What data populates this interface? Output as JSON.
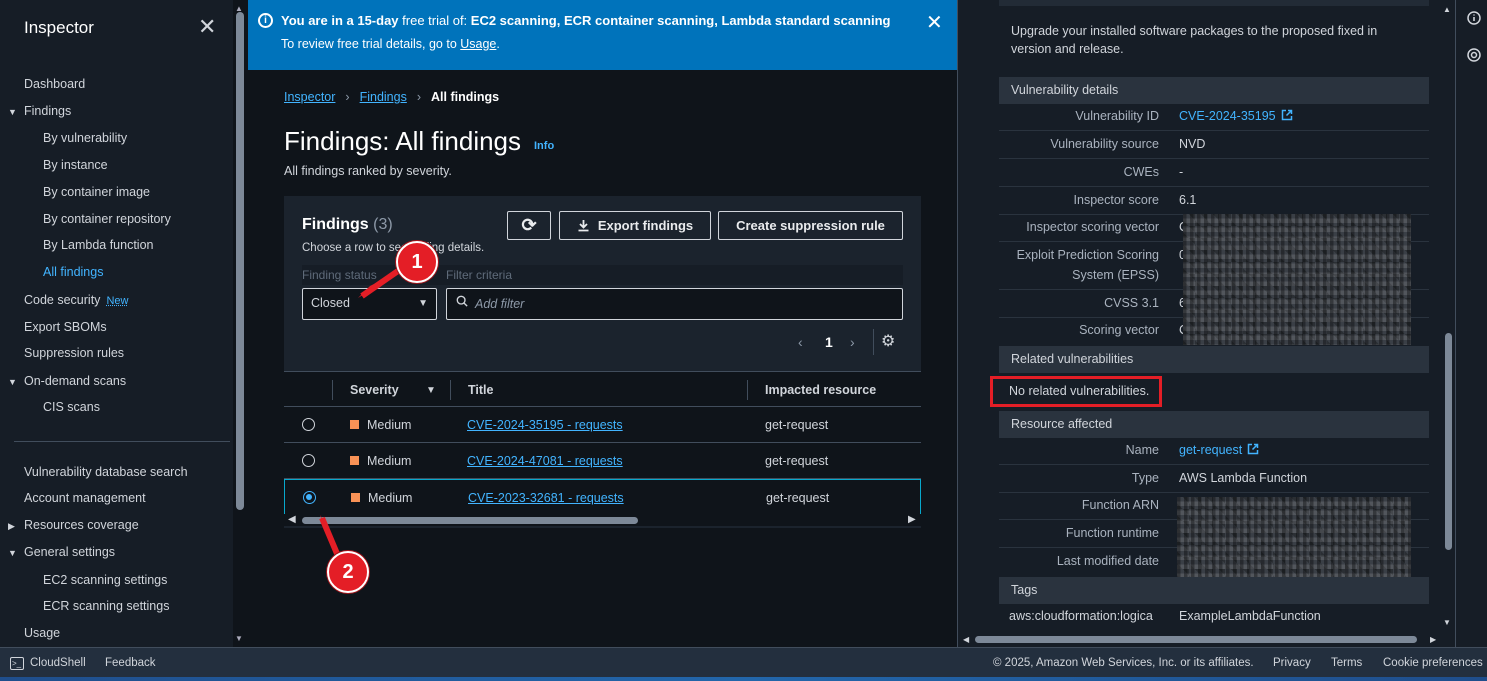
{
  "sidebar": {
    "title": "Inspector",
    "close_icon": "✕",
    "items": [
      {
        "label": "Dashboard"
      },
      {
        "label": "Findings"
      },
      {
        "label": "By vulnerability"
      },
      {
        "label": "By instance"
      },
      {
        "label": "By container image"
      },
      {
        "label": "By container repository"
      },
      {
        "label": "By Lambda function"
      },
      {
        "label": "All findings"
      },
      {
        "label": "Code security",
        "badge": "New"
      },
      {
        "label": "Export SBOMs"
      },
      {
        "label": "Suppression rules"
      },
      {
        "label": "On-demand scans"
      },
      {
        "label": "CIS scans"
      },
      {
        "label": "Vulnerability database search"
      },
      {
        "label": "Account management"
      },
      {
        "label": "Resources coverage"
      },
      {
        "label": "General settings"
      },
      {
        "label": "EC2 scanning settings"
      },
      {
        "label": "ECR scanning settings"
      },
      {
        "label": "Usage"
      }
    ]
  },
  "banner": {
    "prefix": "You are in a 15-day",
    "middle": " free trial of: ",
    "services": "EC2 scanning, ECR container scanning, Lambda standard scanning",
    "line2": "To review free trial details, go to ",
    "link": "Usage",
    "end": "."
  },
  "breadcrumb": {
    "items": [
      "Inspector",
      "Findings",
      "All findings"
    ]
  },
  "page": {
    "title": "Findings: All findings",
    "info": "Info",
    "subtitle": "All findings ranked by severity."
  },
  "findings_panel": {
    "title": "Findings",
    "count": "(3)",
    "description": "Choose a row to see finding details.",
    "refresh_label": "⟳",
    "export_label": "Export findings",
    "suppress_label": "Create suppression rule",
    "status_label": "Finding status",
    "status_value": "Closed",
    "criteria_label": "Filter criteria",
    "filter_placeholder": "Add filter",
    "page_number": "1",
    "columns": [
      "Severity",
      "Title",
      "Impacted resource"
    ],
    "rows": [
      {
        "severity": "Medium",
        "title": "CVE-2024-35195 - requests",
        "resource": "get-request",
        "selected": false
      },
      {
        "severity": "Medium",
        "title": "CVE-2024-47081 - requests",
        "resource": "get-request",
        "selected": false
      },
      {
        "severity": "Medium",
        "title": "CVE-2023-32681 - requests",
        "resource": "get-request",
        "selected": true
      }
    ]
  },
  "markers": {
    "one": "1",
    "two": "2"
  },
  "detail": {
    "remediation": "Upgrade your installed software packages to the proposed fixed in version and release.",
    "vuln_section": "Vulnerability details",
    "vuln_rows": [
      {
        "key": "Vulnerability ID",
        "value": "CVE-2024-35195"
      },
      {
        "key": "Vulnerability source",
        "value": "NVD"
      },
      {
        "key": "CWEs",
        "value": "-"
      },
      {
        "key": "Inspector score",
        "value": "6.1"
      },
      {
        "key": "Inspector scoring vector",
        "value": "C"
      },
      {
        "key": "Exploit Prediction Scoring",
        "key2": "System (EPSS)",
        "value": "0"
      },
      {
        "key": "CVSS 3.1",
        "value": "6"
      },
      {
        "key": "Scoring vector",
        "value": "C"
      }
    ],
    "related_section": "Related vulnerabilities",
    "related_value": "No related vulnerabilities.",
    "resource_section": "Resource affected",
    "resource_rows": [
      {
        "key": "Name",
        "value": "get-request"
      },
      {
        "key": "Type",
        "value": "AWS Lambda Function"
      },
      {
        "key": "Function ARN",
        "value": ""
      },
      {
        "key": "Function runtime",
        "value": ""
      },
      {
        "key": "Last modified date",
        "value": ""
      }
    ],
    "tags_section": "Tags",
    "tag_key": "aws:cloudformation:logica",
    "tag_value": "ExampleLambdaFunction"
  },
  "footer": {
    "cloudshell": "CloudShell",
    "feedback": "Feedback",
    "copyright": "© 2025, Amazon Web Services, Inc. or its affiliates.",
    "privacy": "Privacy",
    "terms": "Terms",
    "cookies": "Cookie preferences"
  },
  "colors": {
    "accent": "#42b4ff",
    "banner": "#0073bb",
    "medium": "#f89256",
    "annotation": "#e41e26"
  }
}
